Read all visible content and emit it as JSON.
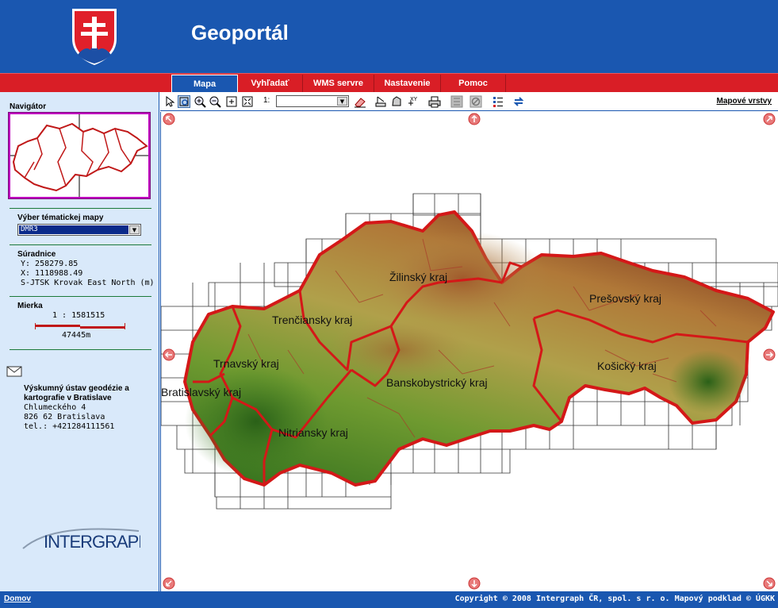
{
  "header": {
    "title": "Geoportál",
    "crest_icon": "slovak-coat-of-arms"
  },
  "menu": {
    "items": [
      {
        "label": "Mapa",
        "active": true
      },
      {
        "label": "Vyhľadať",
        "active": false
      },
      {
        "label": "WMS servre",
        "active": false
      },
      {
        "label": "Nastavenie",
        "active": false
      },
      {
        "label": "Pomoc",
        "active": false
      }
    ]
  },
  "left": {
    "navigator_title": "Navigátor",
    "theme_title": "Výber tématickej mapy",
    "theme_selected": "DMR3",
    "coords_title": "Súradnice",
    "coord_y": "Y: 258279.85",
    "coord_x": "X: 1118988.49",
    "coord_system": "S-JTSK Krovak East North (m)",
    "scale_title": "Mierka",
    "scale_value": "1 : 1581515",
    "scale_bar_label": "47445m",
    "org": {
      "name_line1": "Výskumný ústav geodézie a",
      "name_line2": "kartografie v Bratislave",
      "street": "Chlumeckého 4",
      "city": "826 62 Bratislava",
      "phone": "tel.: +421284111561"
    },
    "logo_text": "INTERGRAPH"
  },
  "toolbar": {
    "scale_prefix": "1:",
    "scale_value": "",
    "layers_link": "Mapové vrstvy",
    "icons": [
      "select-arrow-icon",
      "zoom-box-icon",
      "zoom-in-icon",
      "zoom-out-icon",
      "zoom-full-icon",
      "zoom-extent-icon",
      "eraser-icon",
      "measure-icon",
      "area-icon",
      "xy-coordinate-icon",
      "print-icon",
      "legend-grid-icon",
      "clear-icon",
      "list-icon",
      "refresh-icon"
    ]
  },
  "map": {
    "regions": [
      "Žilinský kraj",
      "Prešovský kraj",
      "Trenčiansky kraj",
      "Trnavský kraj",
      "Košický kraj",
      "Banskobystrický kraj",
      "Bratislavský kraj",
      "Nitriansky kraj"
    ]
  },
  "footer": {
    "home": "Domov",
    "copyright": "Copyright © 2008 Intergraph ČR, spol. s r. o.  Mapový podklad © ÚGKK"
  },
  "colors": {
    "blue": "#1a57b0",
    "red": "#d91e26",
    "panel": "#d9e9fa"
  }
}
